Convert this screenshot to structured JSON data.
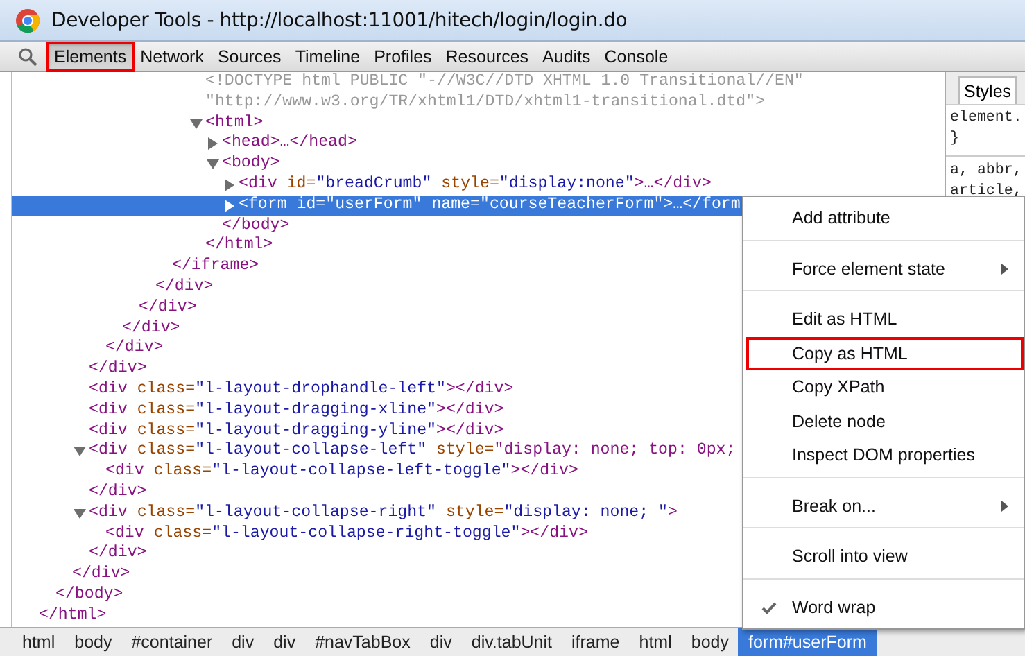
{
  "window": {
    "title": "Developer Tools - http://localhost:11001/hitech/login/login.do"
  },
  "toolbar": {
    "tabs": [
      {
        "label": "Elements",
        "selected": true,
        "annotated": true
      },
      {
        "label": "Network",
        "selected": false,
        "annotated": false
      },
      {
        "label": "Sources",
        "selected": false,
        "annotated": false
      },
      {
        "label": "Timeline",
        "selected": false,
        "annotated": false
      },
      {
        "label": "Profiles",
        "selected": false,
        "annotated": false
      },
      {
        "label": "Resources",
        "selected": false,
        "annotated": false
      },
      {
        "label": "Audits",
        "selected": false,
        "annotated": false
      },
      {
        "label": "Console",
        "selected": false,
        "annotated": false
      }
    ]
  },
  "dom_tree": {
    "nodes": [
      {
        "close": "</html>",
        "children": [
          {
            "close": "</body>",
            "children": [
              {
                "close": "</div>",
                "children": [
                  {
                    "close": "</div>",
                    "children": [
                      {
                        "close": "</div>",
                        "children": [
                          {
                            "close": "</div>",
                            "children": [
                              {
                                "close": "</div>",
                                "children": [
                                  {
                                    "close": "</div>",
                                    "children": [
                                      {
                                        "close": "</iframe>",
                                        "children": [
                                          {
                                            "children": [
                                              {
                                                "kind": "doctype",
                                                "tag": "<!DOCTYPE html PUBLIC \"-//W3C//DTD XHTML 1.0 Transitional//EN\"",
                                                "selected": false
                                              },
                                              {
                                                "kind": "doctype",
                                                "tag": "\"http://www.w3.org/TR/xhtml1/DTD/xhtml1-transitional.dtd\">",
                                                "selected": false
                                              },
                                              {
                                                "kind": "tag",
                                                "tag": "<html>",
                                                "expanded": true,
                                                "selected": false,
                                                "close": "</html>",
                                                "children": [
                                                  {
                                                    "kind": "tag",
                                                    "tag": "<head>…</head>",
                                                    "expanded": false,
                                                    "selected": false
                                                  },
                                                  {
                                                    "kind": "tag",
                                                    "tag": "<body>",
                                                    "expanded": true,
                                                    "selected": false,
                                                    "close": "</body>",
                                                    "children": [
                                                      {
                                                        "kind": "tag",
                                                        "tag": "<div id=\"breadCrumb\" style=\"display:none\">…</div>",
                                                        "expanded": false,
                                                        "selected": false
                                                      },
                                                      {
                                                        "kind": "tag",
                                                        "tag": "<form id=\"userForm\" name=\"courseTeacherForm\">…</form",
                                                        "expanded": false,
                                                        "selected": true
                                                      }
                                                    ]
                                                  }
                                                ]
                                              }
                                            ]
                                          }
                                        ]
                                      }
                                    ]
                                  }
                                ]
                              }
                            ]
                          }
                        ]
                      }
                    ]
                  },
                  {
                    "kind": "tag",
                    "tag": "<div class=\"l-layout-drophandle-left\"></div>",
                    "selected": false
                  },
                  {
                    "kind": "tag",
                    "tag": "<div class=\"l-layout-dragging-xline\"></div>",
                    "selected": false
                  },
                  {
                    "kind": "tag",
                    "tag": "<div class=\"l-layout-dragging-yline\"></div>",
                    "selected": false
                  },
                  {
                    "kind": "tag",
                    "tag": "<div class=\"l-layout-collapse-left\" style=\"display: none; top: 0px;",
                    "expanded": true,
                    "selected": false,
                    "close": "</div>",
                    "children": [
                      {
                        "kind": "tag",
                        "tag": "<div class=\"l-layout-collapse-left-toggle\"></div>",
                        "selected": false
                      }
                    ]
                  },
                  {
                    "kind": "tag",
                    "tag": "<div class=\"l-layout-collapse-right\" style=\"display: none; \">",
                    "expanded": true,
                    "selected": false,
                    "close": "</div>",
                    "children": [
                      {
                        "kind": "tag",
                        "tag": "<div class=\"l-layout-collapse-right-toggle\"></div>",
                        "selected": false
                      }
                    ]
                  }
                ]
              }
            ]
          }
        ]
      }
    ]
  },
  "styles_panel": {
    "tab": "Styles",
    "lines": [
      "element.",
      "}",
      "a, abbr,",
      "article,"
    ]
  },
  "context_menu": {
    "groups": [
      {
        "items": [
          {
            "label": "Add attribute",
            "submenu": false,
            "checked": false,
            "annotated": false
          }
        ]
      },
      {
        "items": [
          {
            "label": "Force element state",
            "submenu": true,
            "checked": false,
            "annotated": false
          }
        ]
      },
      {
        "items": [
          {
            "label": "Edit as HTML",
            "submenu": false,
            "checked": false,
            "annotated": false
          },
          {
            "label": "Copy as HTML",
            "submenu": false,
            "checked": false,
            "annotated": true
          },
          {
            "label": "Copy XPath",
            "submenu": false,
            "checked": false,
            "annotated": false
          },
          {
            "label": "Delete node",
            "submenu": false,
            "checked": false,
            "annotated": false
          },
          {
            "label": "Inspect DOM properties",
            "submenu": false,
            "checked": false,
            "annotated": false
          }
        ]
      },
      {
        "items": [
          {
            "label": "Break on...",
            "submenu": true,
            "checked": false,
            "annotated": false
          }
        ]
      },
      {
        "items": [
          {
            "label": "Scroll into view",
            "submenu": false,
            "checked": false,
            "annotated": false
          }
        ]
      },
      {
        "items": [
          {
            "label": "Word wrap",
            "submenu": false,
            "checked": true,
            "annotated": false
          }
        ]
      }
    ]
  },
  "breadcrumbs": [
    {
      "label": "html",
      "selected": false
    },
    {
      "label": "body",
      "selected": false
    },
    {
      "label": "#container",
      "selected": false
    },
    {
      "label": "div",
      "selected": false
    },
    {
      "label": "div",
      "selected": false
    },
    {
      "label": "#navTabBox",
      "selected": false
    },
    {
      "label": "div",
      "selected": false
    },
    {
      "label": "div.tabUnit",
      "selected": false
    },
    {
      "label": "iframe",
      "selected": false
    },
    {
      "label": "html",
      "selected": false
    },
    {
      "label": "body",
      "selected": false
    },
    {
      "label": "form#userForm",
      "selected": true
    }
  ]
}
